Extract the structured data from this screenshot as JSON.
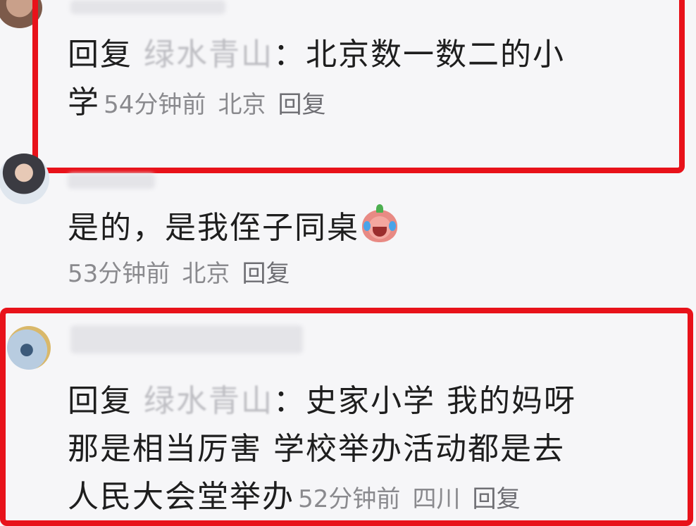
{
  "comment1": {
    "reply_prefix": "回复",
    "quoted_user": "绿水青山",
    "text_line1": "：北京数一数二的小",
    "text_line2": "学",
    "time": "54分钟前",
    "location": "北京",
    "reply_action": "回复"
  },
  "comment2": {
    "text": "是的，是我侄子同桌",
    "emoji": "crying-laughing-emoji",
    "time": "53分钟前",
    "location": "北京",
    "reply_action": "回复"
  },
  "comment3": {
    "reply_prefix": "回复",
    "quoted_user": "绿水青山",
    "text_line1": "：史家小学 我的妈呀",
    "text_line2": "那是相当厉害 学校举办活动都是去",
    "text_line3": "人民大会堂举办",
    "time": "52分钟前",
    "location": "四川",
    "reply_action": "回复"
  },
  "colors": {
    "highlight_border": "#e8121a",
    "meta_text": "#8a8a8e",
    "background": "#f6f6f8"
  }
}
